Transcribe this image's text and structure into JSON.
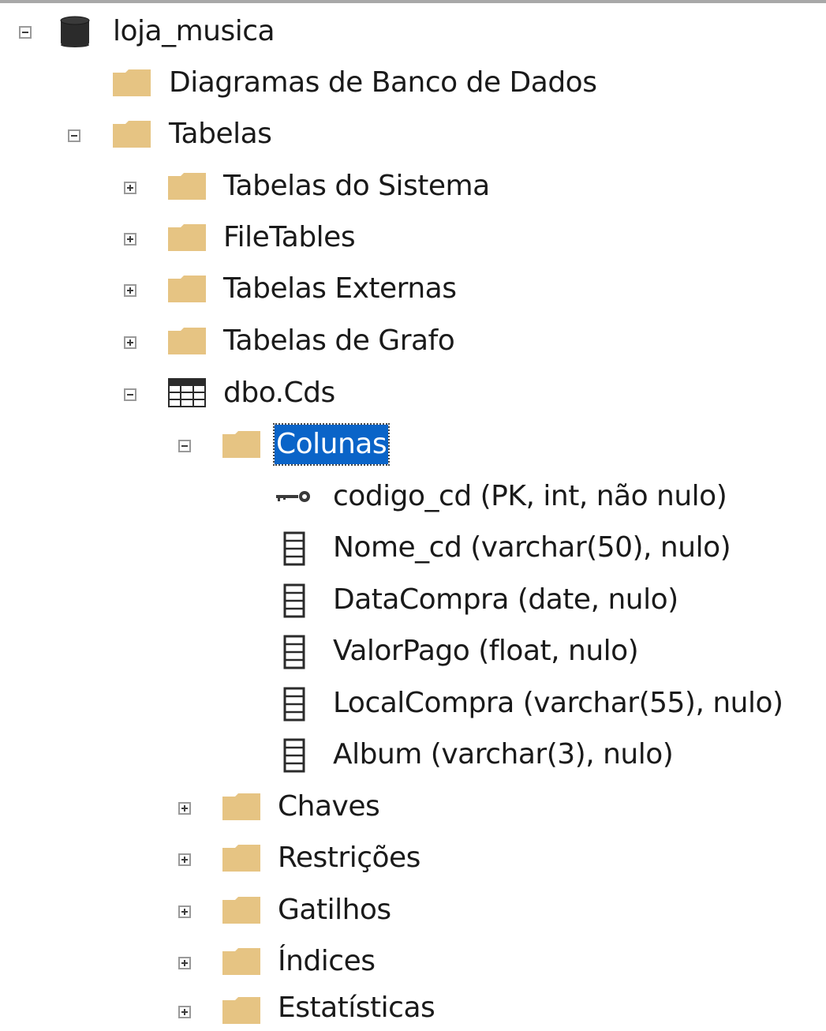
{
  "tree": {
    "root": {
      "label": "loja_musica",
      "icon": "database-icon",
      "state": "expanded"
    },
    "diagrams": {
      "label": "Diagramas de Banco de Dados",
      "icon": "folder-icon"
    },
    "tables": {
      "label": "Tabelas",
      "icon": "folder-icon",
      "state": "expanded"
    },
    "system_tables": {
      "label": "Tabelas do Sistema",
      "icon": "folder-icon",
      "state": "collapsed"
    },
    "file_tables": {
      "label": "FileTables",
      "icon": "folder-icon",
      "state": "collapsed"
    },
    "external_tables": {
      "label": "Tabelas Externas",
      "icon": "folder-icon",
      "state": "collapsed"
    },
    "graph_tables": {
      "label": "Tabelas de Grafo",
      "icon": "folder-icon",
      "state": "collapsed"
    },
    "table_cds": {
      "label": "dbo.Cds",
      "icon": "table-icon",
      "state": "expanded"
    },
    "columns": {
      "label": "Colunas",
      "icon": "folder-icon",
      "state": "expanded",
      "selected": true
    },
    "column_items": [
      {
        "label": "codigo_cd (PK, int, não nulo)",
        "icon": "key-icon"
      },
      {
        "label": "Nome_cd (varchar(50), nulo)",
        "icon": "column-icon"
      },
      {
        "label": "DataCompra (date, nulo)",
        "icon": "column-icon"
      },
      {
        "label": "ValorPago (float, nulo)",
        "icon": "column-icon"
      },
      {
        "label": "LocalCompra (varchar(55), nulo)",
        "icon": "column-icon"
      },
      {
        "label": "Album (varchar(3), nulo)",
        "icon": "column-icon"
      }
    ],
    "keys": {
      "label": "Chaves",
      "icon": "folder-icon",
      "state": "collapsed"
    },
    "constraints": {
      "label": "Restrições",
      "icon": "folder-icon",
      "state": "collapsed"
    },
    "triggers": {
      "label": "Gatilhos",
      "icon": "folder-icon",
      "state": "collapsed"
    },
    "indexes": {
      "label": "Índices",
      "icon": "folder-icon",
      "state": "collapsed"
    },
    "statistics": {
      "label": "Estatísticas",
      "icon": "folder-icon",
      "state": "collapsed"
    }
  },
  "colors": {
    "folder": "#e6c483",
    "folder_dark": "#d8b06a",
    "selection": "#0a64c8",
    "database": "#2b2b2b"
  }
}
